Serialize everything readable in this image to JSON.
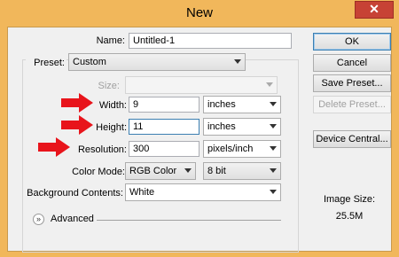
{
  "window": {
    "title": "New",
    "close_symbol": "✕"
  },
  "form": {
    "name_label": "Name:",
    "name_value": "Untitled-1",
    "preset_label": "Preset:",
    "preset_value": "Custom",
    "size_label": "Size:",
    "size_value": "",
    "width_label": "Width:",
    "width_value": "9",
    "width_unit": "inches",
    "height_label": "Height:",
    "height_value": "11",
    "height_unit": "inches",
    "resolution_label": "Resolution:",
    "resolution_value": "300",
    "resolution_unit": "pixels/inch",
    "color_mode_label": "Color Mode:",
    "color_mode_value": "RGB Color",
    "bit_depth_value": "8 bit",
    "background_label": "Background Contents:",
    "background_value": "White",
    "advanced_label": "Advanced",
    "advanced_icon": "»"
  },
  "buttons": {
    "ok": "OK",
    "cancel": "Cancel",
    "save_preset": "Save Preset...",
    "delete_preset": "Delete Preset...",
    "device_central": "Device Central..."
  },
  "info": {
    "image_size_label": "Image Size:",
    "image_size_value": "25.5M"
  },
  "colors": {
    "titlebar": "#f1b75b",
    "close_button": "#c74235",
    "arrow": "#e8141b"
  }
}
